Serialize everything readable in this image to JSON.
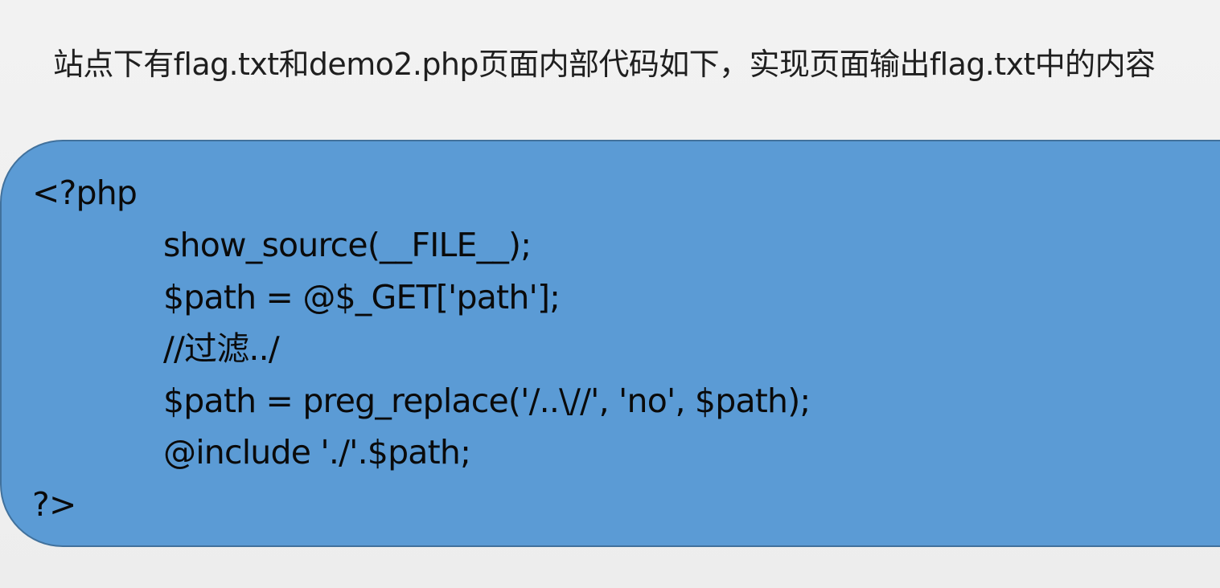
{
  "heading": "站点下有flag.txt和demo2.php页面内部代码如下，实现页面输出flag.txt中的内容",
  "code": {
    "open_tag": "<?php",
    "lines": [
      "show_source(__FILE__);",
      "$path = @$_GET['path'];",
      "//过滤../",
      "$path = preg_replace('/..\\//', 'no', $path);",
      "@include './'.$path;"
    ],
    "close_tag": "?>"
  },
  "colors": {
    "background": "#f0f0f0",
    "panel_fill": "#5b9bd5",
    "panel_border": "#41719c",
    "text": "#1f1f1f"
  }
}
